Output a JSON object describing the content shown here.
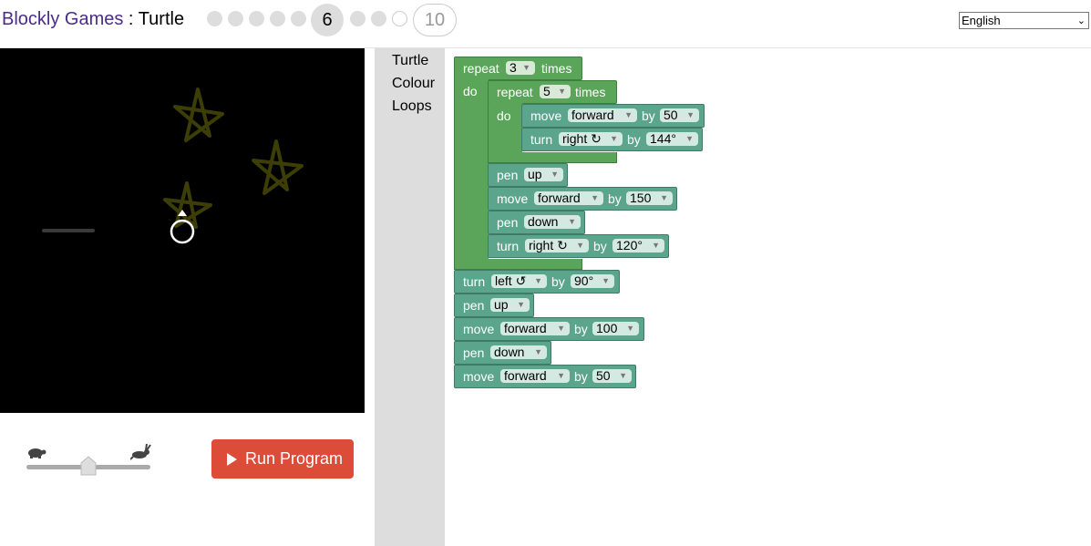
{
  "app": {
    "brand": "Blockly Games",
    "separator": " : ",
    "game": "Turtle"
  },
  "levels": {
    "current": "6",
    "last": "10"
  },
  "language": {
    "selected": "English"
  },
  "toolbox": [
    "Turtle",
    "Colour",
    "Loops"
  ],
  "run_button": {
    "label": "Run Program"
  },
  "speed_slider": {
    "value": 0.5
  },
  "colors": {
    "brand": "#4b2c8a",
    "run": "#dd4b39",
    "loop_block": "#5ba55b",
    "turtle_block": "#5ba58c"
  },
  "icons": {
    "tortoise": "tortoise-icon",
    "hare": "hare-icon",
    "play": "play-icon",
    "turtle_cursor": "turtle-cursor-icon"
  },
  "blocks": {
    "repeat_outer": {
      "keyword": "repeat",
      "count": "3",
      "times": "times",
      "do": "do"
    },
    "repeat_inner": {
      "keyword": "repeat",
      "count": "5",
      "times": "times",
      "do": "do"
    },
    "b1": {
      "keyword": "move",
      "dir": "forward",
      "by": "by",
      "value": "50"
    },
    "b2": {
      "keyword": "turn",
      "dir": "right ↻",
      "by": "by",
      "value": "144°"
    },
    "b3": {
      "keyword": "pen",
      "state": "up"
    },
    "b4": {
      "keyword": "move",
      "dir": "forward",
      "by": "by",
      "value": "150"
    },
    "b5": {
      "keyword": "pen",
      "state": "down"
    },
    "b6": {
      "keyword": "turn",
      "dir": "right ↻",
      "by": "by",
      "value": "120°"
    },
    "b7": {
      "keyword": "turn",
      "dir": "left ↺",
      "by": "by",
      "value": "90°"
    },
    "b8": {
      "keyword": "pen",
      "state": "up"
    },
    "b9": {
      "keyword": "move",
      "dir": "forward",
      "by": "by",
      "value": "100"
    },
    "b10": {
      "keyword": "pen",
      "state": "down"
    },
    "b11": {
      "keyword": "move",
      "dir": "forward",
      "by": "by",
      "value": "50"
    }
  }
}
